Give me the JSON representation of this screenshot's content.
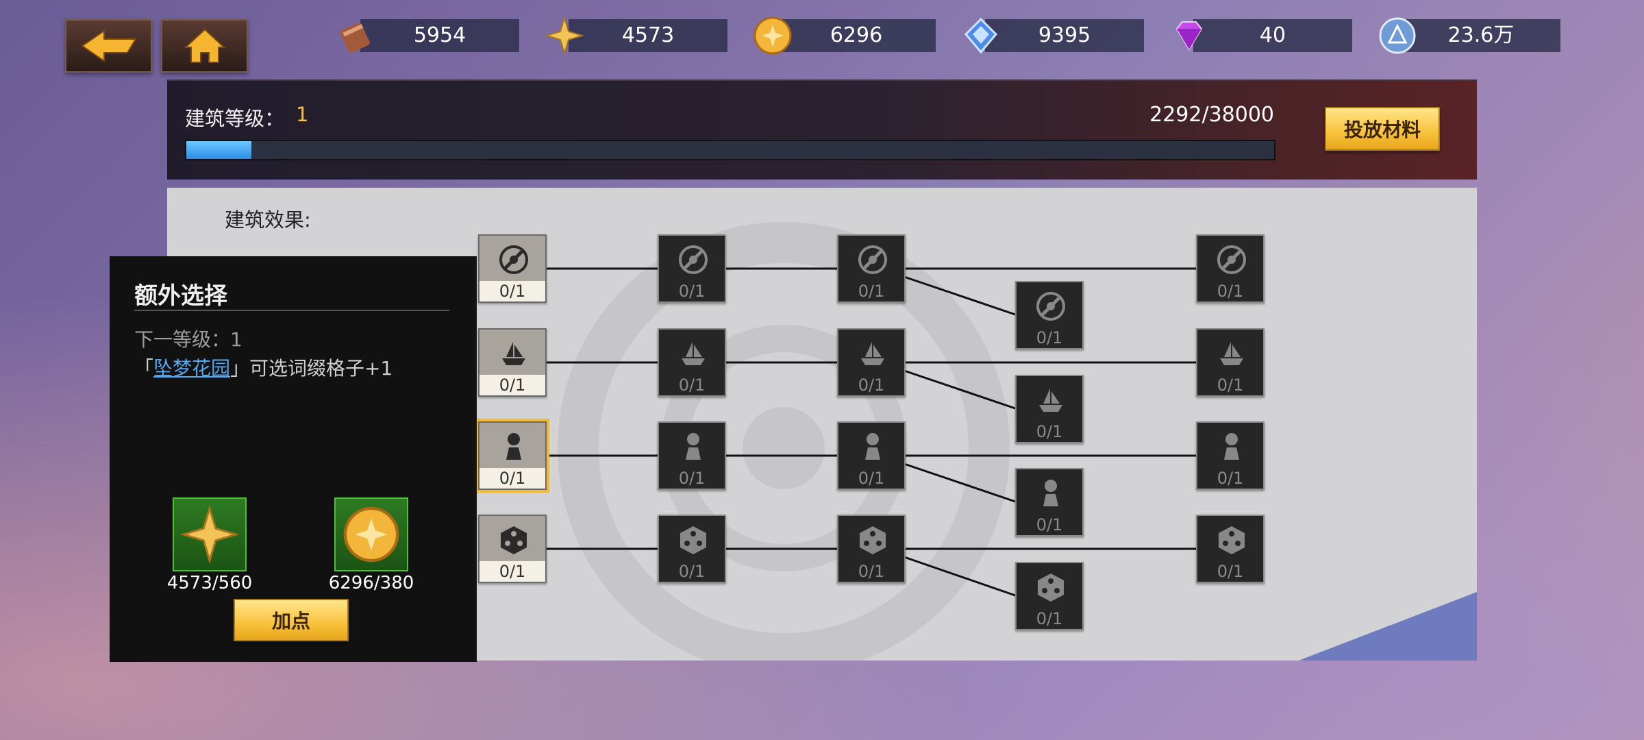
{
  "currencies": [
    {
      "icon": "scroll-icon",
      "value": "5954"
    },
    {
      "icon": "gold-star-icon",
      "value": "4573"
    },
    {
      "icon": "gold-coin-icon",
      "value": "6296"
    },
    {
      "icon": "blue-badge-icon",
      "value": "9395"
    },
    {
      "icon": "purple-diamond-icon",
      "value": "40"
    },
    {
      "icon": "blue-orb-icon",
      "value": "23.6万"
    }
  ],
  "building": {
    "level_label": "建筑等级：",
    "level_value": "1",
    "progress_text": "2292/38000",
    "progress_fraction": 0.06,
    "submit_button": "投放材料",
    "effects_label": "建筑效果:"
  },
  "nodes": {
    "count_text": "0/1"
  },
  "tooltip": {
    "title": "额外选择",
    "next_level": "下一等级：1",
    "desc_prefix": "「",
    "desc_link": "坠梦花园",
    "desc_suffix": "」可选词缀格子+1",
    "cost1": "4573/560",
    "cost2": "6296/380",
    "add_button": "加点"
  },
  "colors": {
    "accent_gold": "#f6c244",
    "progress_blue": "#3aa3f5",
    "link_blue": "#55a9f2"
  }
}
